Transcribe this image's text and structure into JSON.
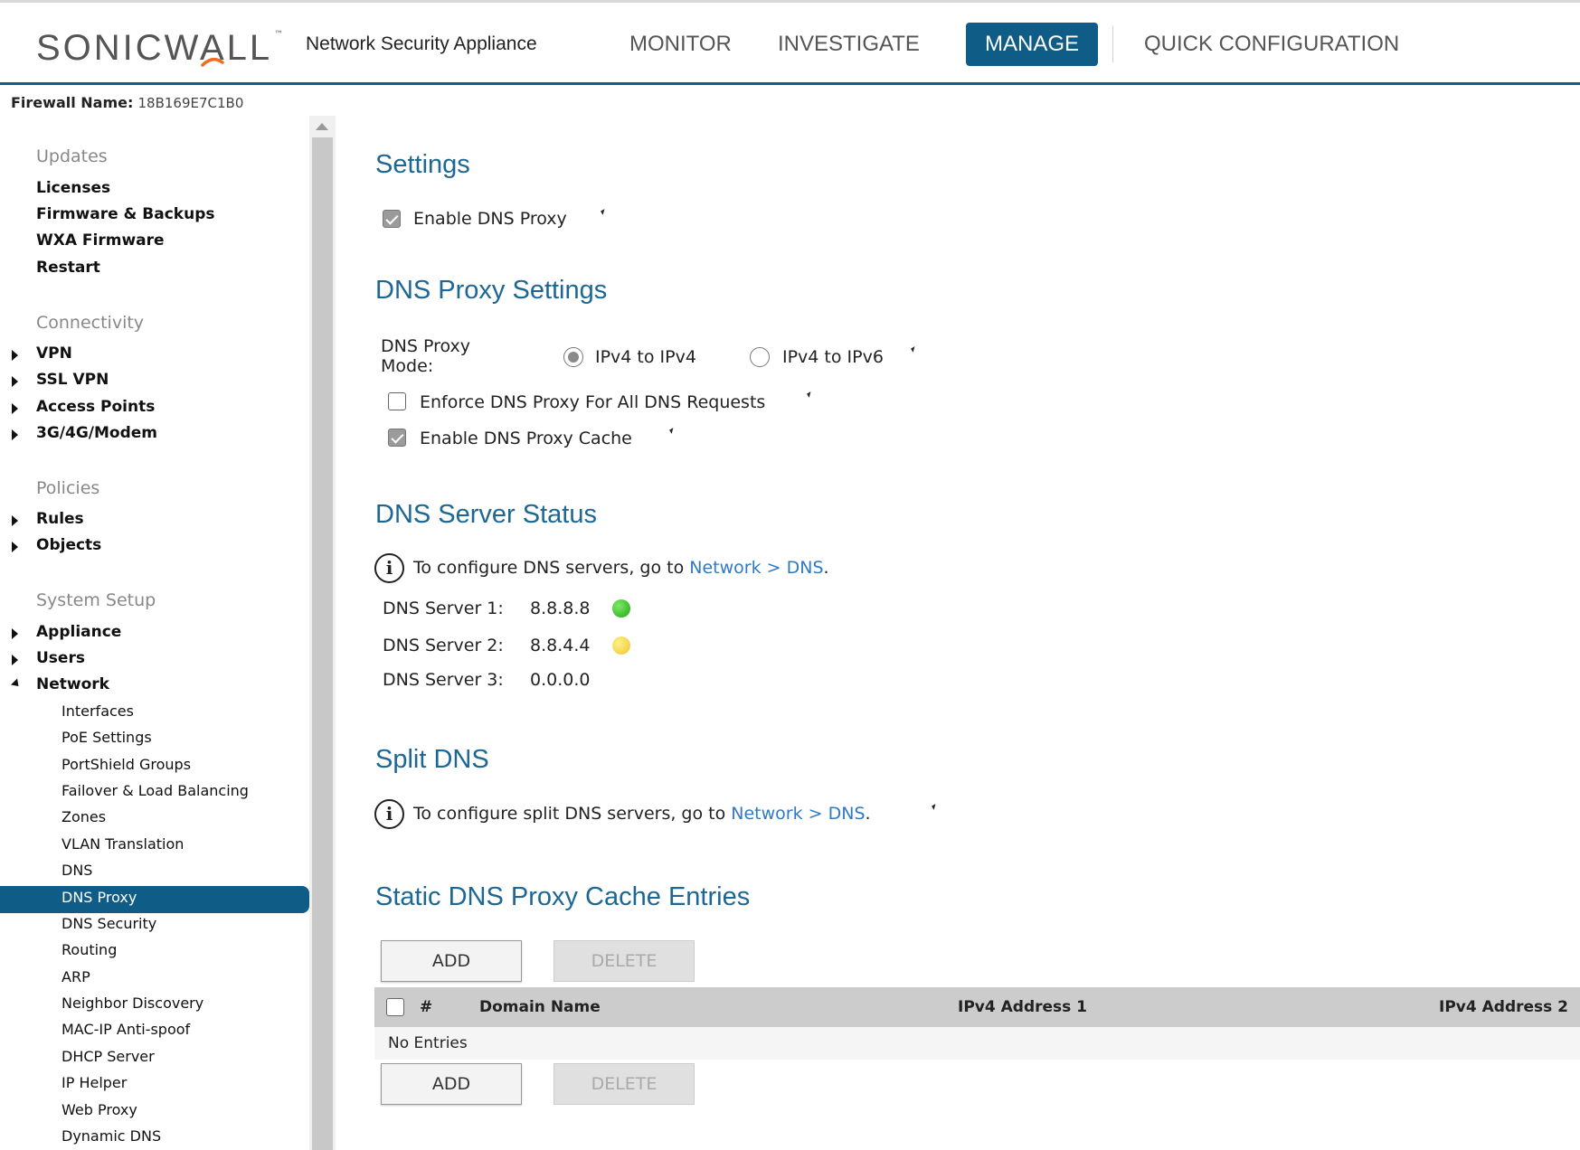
{
  "app": {
    "brand": "SONICWALL",
    "brand_tm": "™",
    "product": "Network Security Appliance"
  },
  "topnav": {
    "tabs": [
      {
        "label": "MONITOR",
        "active": false
      },
      {
        "label": "INVESTIGATE",
        "active": false
      },
      {
        "label": "MANAGE",
        "active": true
      },
      {
        "label": "QUICK CONFIGURATION",
        "active": false
      }
    ],
    "accent_color": "#0f5c86"
  },
  "firewall": {
    "label": "Firewall Name:",
    "value": "18B169E7C1B0"
  },
  "sidebar": {
    "groups": {
      "updates": "Updates",
      "connectivity": "Connectivity",
      "policies": "Policies",
      "system_setup": "System Setup"
    },
    "updates_items": [
      "Licenses",
      "Firmware & Backups",
      "WXA Firmware",
      "Restart"
    ],
    "connectivity_items": [
      "VPN",
      "SSL VPN",
      "Access Points",
      "3G/4G/Modem"
    ],
    "policies_items": [
      "Rules",
      "Objects"
    ],
    "system_items": [
      "Appliance",
      "Users",
      "Network"
    ],
    "network_sub": [
      "Interfaces",
      "PoE Settings",
      "PortShield Groups",
      "Failover & Load Balancing",
      "Zones",
      "VLAN Translation",
      "DNS",
      "DNS Proxy",
      "DNS Security",
      "Routing",
      "ARP",
      "Neighbor Discovery",
      "MAC-IP Anti-spoof",
      "DHCP Server",
      "IP Helper",
      "Web Proxy",
      "Dynamic DNS"
    ],
    "active_item": "DNS Proxy"
  },
  "settings": {
    "title": "Settings",
    "enable_dns_proxy": {
      "label": "Enable DNS Proxy",
      "checked": true
    }
  },
  "proxy_settings": {
    "title": "DNS Proxy Settings",
    "mode_label_line1": "DNS Proxy",
    "mode_label_line2": "Mode:",
    "mode_options": [
      {
        "label": "IPv4 to IPv4",
        "selected": true
      },
      {
        "label": "IPv4 to IPv6",
        "selected": false
      }
    ],
    "enforce": {
      "label": "Enforce DNS Proxy For All DNS Requests",
      "checked": false
    },
    "cache": {
      "label": "Enable DNS Proxy Cache",
      "checked": true
    }
  },
  "server_status": {
    "title": "DNS Server Status",
    "info_prefix": "To configure DNS servers, go to ",
    "info_link": "Network > DNS",
    "info_suffix": ".",
    "servers": [
      {
        "label": "DNS Server 1:",
        "value": "8.8.8.8",
        "status": "green",
        "color": "#2dbb18"
      },
      {
        "label": "DNS Server 2:",
        "value": "8.8.4.4",
        "status": "yellow",
        "color": "#f2d43a"
      },
      {
        "label": "DNS Server 3:",
        "value": "0.0.0.0",
        "status": "none"
      }
    ]
  },
  "split_dns": {
    "title": "Split DNS",
    "info_prefix": "To configure split DNS servers, go to ",
    "info_link": "Network > DNS",
    "info_suffix": "."
  },
  "static_cache": {
    "title": "Static DNS Proxy Cache Entries",
    "add_label": "ADD",
    "delete_label": "DELETE",
    "columns": [
      "#",
      "Domain Name",
      "IPv4 Address 1",
      "IPv4 Address 2"
    ],
    "empty_text": "No Entries"
  }
}
